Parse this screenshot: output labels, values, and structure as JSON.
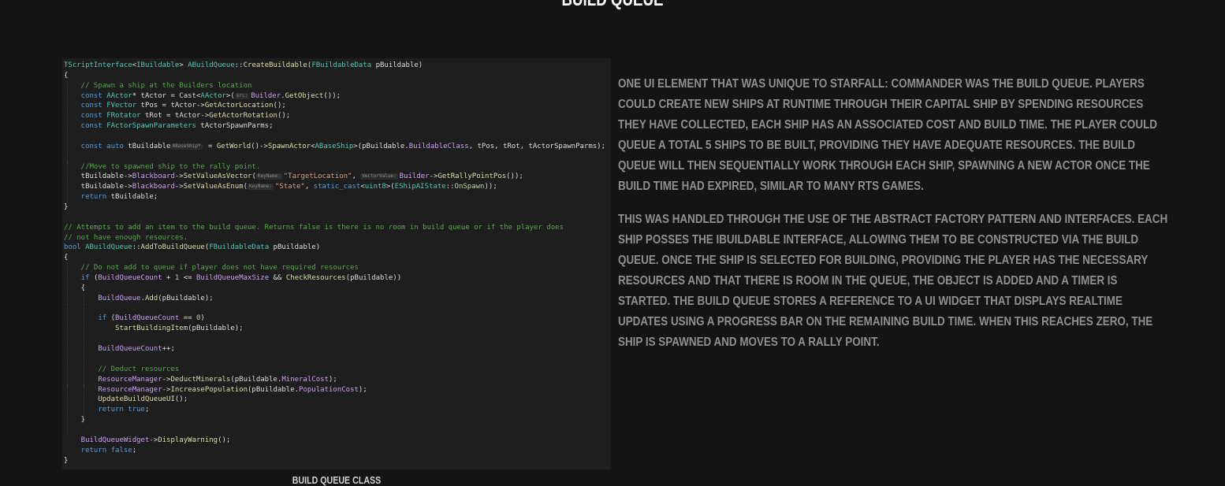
{
  "section": {
    "title": "BUILD QUEUE"
  },
  "code_caption": "BUILD QUEUE CLASS",
  "description": {
    "paragraphs": [
      "ONE UI ELEMENT THAT WAS UNIQUE TO STARFALL: COMMANDER WAS THE BUILD QUEUE. PLAYERS COULD CREATE NEW SHIPS AT RUNTIME THROUGH THEIR CAPITAL SHIP BY SPENDING RESOURCES THEY HAVE COLLECTED, EACH SHIP HAS AN ASSOCIATED COST AND BUILD TIME. THE PLAYER COULD QUEUE A TOTAL 5 SHIPS TO BE BUILT, PROVIDING THEY HAVE ADEQUATE RESOURCES. THE BUILD QUEUE WILL THEN SEQUENTIALLY WORK THROUGH EACH SHIP, SPAWNING A NEW ACTOR ONCE THE BUILD TIME HAD EXPIRED, SIMILAR TO MANY RTS GAMES.",
      "THIS WAS HANDLED THROUGH THE USE OF THE ABSTRACT FACTORY PATTERN AND INTERFACES. EACH SHIP POSSES THE IBUILDABLE INTERFACE, ALLOWING THEM TO BE CONSTRUCTED VIA THE BUILD QUEUE.  ONCE THE SHIP IS SELECTED FOR BUILDING, PROVIDING THE PLAYER HAS THE NECESSARY RESOURCES AND THAT THERE IS ROOM IN THE QUEUE, THE OBJECT IS ADDED AND A TIMER IS STARTED. THE BUILD QUEUE STORES A REFERENCE TO A UI WIDGET THAT DISPLAYS REALTIME UPDATES USING A PROGRESS BAR ON THE REMAINING BUILD TIME. WHEN THIS REACHES ZERO, THE SHIP IS SPAWNED AND MOVES TO A RALLY POINT."
    ]
  },
  "code": {
    "hints": {
      "src": "src:",
      "abaseship": "ABaseShip*",
      "keyname": "KeyName:",
      "vectorvalue": "VectorValue:"
    },
    "lines": [
      {
        "segs": [
          {
            "c": "ty",
            "t": "TScriptInterface"
          },
          {
            "c": "",
            "t": "<"
          },
          {
            "c": "ty",
            "t": "IBuildable"
          },
          {
            "c": "",
            "t": "> "
          },
          {
            "c": "ty",
            "t": "ABuildQueue"
          },
          {
            "c": "",
            "t": "::"
          },
          {
            "c": "fn",
            "t": "CreateBuildable"
          },
          {
            "c": "",
            "t": "("
          },
          {
            "c": "ty",
            "t": "FBuildableData"
          },
          {
            "c": "",
            "t": " pBuildable)"
          }
        ]
      },
      {
        "segs": [
          {
            "c": "",
            "t": "{"
          }
        ]
      },
      {
        "segs": [
          {
            "c": "cm",
            "t": "    // Spawn a ship at the Builders location"
          }
        ]
      },
      {
        "segs": [
          {
            "c": "kw",
            "t": "    const "
          },
          {
            "c": "ty",
            "t": "AActor"
          },
          {
            "c": "",
            "t": "* tActor = Cast<"
          },
          {
            "c": "ty",
            "t": "AActor"
          },
          {
            "c": "",
            "t": ">("
          },
          {
            "c": "hint",
            "t": "src:"
          },
          {
            "c": "mb",
            "t": "Builder"
          },
          {
            "c": "",
            "t": "."
          },
          {
            "c": "fn",
            "t": "GetObject"
          },
          {
            "c": "",
            "t": "());"
          }
        ]
      },
      {
        "segs": [
          {
            "c": "kw",
            "t": "    const "
          },
          {
            "c": "ty",
            "t": "FVector"
          },
          {
            "c": "",
            "t": " tPos = tActor->"
          },
          {
            "c": "fn",
            "t": "GetActorLocation"
          },
          {
            "c": "",
            "t": "();"
          }
        ]
      },
      {
        "segs": [
          {
            "c": "kw",
            "t": "    const "
          },
          {
            "c": "ty",
            "t": "FRotator"
          },
          {
            "c": "",
            "t": " tRot = tActor->"
          },
          {
            "c": "fn",
            "t": "GetActorRotation"
          },
          {
            "c": "",
            "t": "();"
          }
        ]
      },
      {
        "segs": [
          {
            "c": "kw",
            "t": "    const "
          },
          {
            "c": "ty",
            "t": "FActorSpawnParameters"
          },
          {
            "c": "",
            "t": " tActorSpawnParms;"
          }
        ]
      },
      {
        "segs": [
          {
            "c": "",
            "t": " "
          }
        ]
      },
      {
        "segs": [
          {
            "c": "kw",
            "t": "    const auto "
          },
          {
            "c": "",
            "t": "tBuildable"
          },
          {
            "c": "hint",
            "t": "ABaseShip*"
          },
          {
            "c": "",
            "t": " = "
          },
          {
            "c": "fn",
            "t": "GetWorld"
          },
          {
            "c": "",
            "t": "()->"
          },
          {
            "c": "fn",
            "t": "SpawnActor"
          },
          {
            "c": "",
            "t": "<"
          },
          {
            "c": "ty",
            "t": "ABaseShip"
          },
          {
            "c": "",
            "t": ">(pBuildable."
          },
          {
            "c": "mb",
            "t": "BuildableClass"
          },
          {
            "c": "",
            "t": ", tPos, tRot, tActorSpawnParms);"
          }
        ]
      },
      {
        "segs": [
          {
            "c": "",
            "t": " "
          }
        ]
      },
      {
        "segs": [
          {
            "c": "cm",
            "t": "    //Move to spawned ship to the rally point."
          }
        ]
      },
      {
        "segs": [
          {
            "c": "",
            "t": "    tBuildable->"
          },
          {
            "c": "mb",
            "t": "Blackboard"
          },
          {
            "c": "",
            "t": "->"
          },
          {
            "c": "fn",
            "t": "SetValueAsVector"
          },
          {
            "c": "",
            "t": "("
          },
          {
            "c": "hint",
            "t": "KeyName:"
          },
          {
            "c": "st",
            "t": "\"TargetLocation\""
          },
          {
            "c": "",
            "t": ", "
          },
          {
            "c": "hint",
            "t": "VectorValue:"
          },
          {
            "c": "mb",
            "t": "Builder"
          },
          {
            "c": "",
            "t": "->"
          },
          {
            "c": "fn",
            "t": "GetRallyPointPos"
          },
          {
            "c": "",
            "t": "());"
          }
        ]
      },
      {
        "segs": [
          {
            "c": "",
            "t": "    tBuildable->"
          },
          {
            "c": "mb",
            "t": "Blackboard"
          },
          {
            "c": "",
            "t": "->"
          },
          {
            "c": "fn",
            "t": "SetValueAsEnum"
          },
          {
            "c": "",
            "t": "("
          },
          {
            "c": "hint",
            "t": "KeyName:"
          },
          {
            "c": "st",
            "t": "\"State\""
          },
          {
            "c": "",
            "t": ", "
          },
          {
            "c": "kw",
            "t": "static_cast"
          },
          {
            "c": "",
            "t": "<"
          },
          {
            "c": "ty",
            "t": "uint8"
          },
          {
            "c": "",
            "t": ">("
          },
          {
            "c": "ty",
            "t": "EShipAIState"
          },
          {
            "c": "",
            "t": "::"
          },
          {
            "c": "en",
            "t": "OnSpawn"
          },
          {
            "c": "",
            "t": "));"
          }
        ]
      },
      {
        "segs": [
          {
            "c": "kw",
            "t": "    return "
          },
          {
            "c": "",
            "t": "tBuildable;"
          }
        ]
      },
      {
        "segs": [
          {
            "c": "",
            "t": "}"
          }
        ]
      },
      {
        "segs": [
          {
            "c": "",
            "t": " "
          }
        ]
      },
      {
        "segs": [
          {
            "c": "cm",
            "t": "// Attempts to add an item to the build queue. Returns false is there is no room in build queue or if the player does"
          }
        ]
      },
      {
        "segs": [
          {
            "c": "cm",
            "t": "// not have enough resources."
          }
        ]
      },
      {
        "segs": [
          {
            "c": "kw",
            "t": "bool "
          },
          {
            "c": "ty",
            "t": "ABuildQueue"
          },
          {
            "c": "",
            "t": "::"
          },
          {
            "c": "fn",
            "t": "AddToBuildQueue"
          },
          {
            "c": "",
            "t": "("
          },
          {
            "c": "ty",
            "t": "FBuildableData"
          },
          {
            "c": "",
            "t": " pBuildable)"
          }
        ]
      },
      {
        "segs": [
          {
            "c": "",
            "t": "{"
          }
        ]
      },
      {
        "segs": [
          {
            "c": "cm",
            "t": "    // Do not add to queue if player does not have required resources"
          }
        ]
      },
      {
        "segs": [
          {
            "c": "kw",
            "t": "    if "
          },
          {
            "c": "",
            "t": "("
          },
          {
            "c": "mb",
            "t": "BuildQueueCount"
          },
          {
            "c": "",
            "t": " + "
          },
          {
            "c": "nm",
            "t": "1"
          },
          {
            "c": "",
            "t": " <= "
          },
          {
            "c": "mb",
            "t": "BuildQueueMaxSize"
          },
          {
            "c": "",
            "t": " && "
          },
          {
            "c": "fn",
            "t": "CheckResources"
          },
          {
            "c": "",
            "t": "(pBuildable))"
          }
        ]
      },
      {
        "segs": [
          {
            "c": "",
            "t": "    {"
          }
        ]
      },
      {
        "segs": [
          {
            "c": "mb",
            "t": "        BuildQueue"
          },
          {
            "c": "",
            "t": "."
          },
          {
            "c": "fn",
            "t": "Add"
          },
          {
            "c": "",
            "t": "(pBuildable);"
          }
        ]
      },
      {
        "segs": [
          {
            "c": "",
            "t": " "
          }
        ]
      },
      {
        "segs": [
          {
            "c": "kw",
            "t": "        if "
          },
          {
            "c": "",
            "t": "("
          },
          {
            "c": "mb",
            "t": "BuildQueueCount"
          },
          {
            "c": "",
            "t": " == "
          },
          {
            "c": "nm",
            "t": "0"
          },
          {
            "c": "",
            "t": ")"
          }
        ]
      },
      {
        "segs": [
          {
            "c": "fn",
            "t": "            StartBuildingItem"
          },
          {
            "c": "",
            "t": "(pBuildable);"
          }
        ]
      },
      {
        "segs": [
          {
            "c": "",
            "t": " "
          }
        ]
      },
      {
        "segs": [
          {
            "c": "mb",
            "t": "        BuildQueueCount"
          },
          {
            "c": "",
            "t": "++;"
          }
        ]
      },
      {
        "segs": [
          {
            "c": "",
            "t": " "
          }
        ]
      },
      {
        "segs": [
          {
            "c": "cm",
            "t": "        // Deduct resources"
          }
        ]
      },
      {
        "segs": [
          {
            "c": "mb",
            "t": "        ResourceManager"
          },
          {
            "c": "",
            "t": "->"
          },
          {
            "c": "fn",
            "t": "DeductMinerals"
          },
          {
            "c": "",
            "t": "(pBuildable."
          },
          {
            "c": "mb",
            "t": "MineralCost"
          },
          {
            "c": "",
            "t": ");"
          }
        ]
      },
      {
        "segs": [
          {
            "c": "mb",
            "t": "        ResourceManager"
          },
          {
            "c": "",
            "t": "->"
          },
          {
            "c": "fn",
            "t": "IncreasePopulation"
          },
          {
            "c": "",
            "t": "(pBuildable."
          },
          {
            "c": "mb",
            "t": "PopulationCost"
          },
          {
            "c": "",
            "t": ");"
          }
        ]
      },
      {
        "segs": [
          {
            "c": "fn",
            "t": "        UpdateBuildQueueUI"
          },
          {
            "c": "",
            "t": "();"
          }
        ]
      },
      {
        "segs": [
          {
            "c": "kw",
            "t": "        return true"
          },
          {
            "c": "",
            "t": ";"
          }
        ]
      },
      {
        "segs": [
          {
            "c": "",
            "t": "    }"
          }
        ]
      },
      {
        "segs": [
          {
            "c": "",
            "t": " "
          }
        ]
      },
      {
        "segs": [
          {
            "c": "mb",
            "t": "    BuildQueueWidget"
          },
          {
            "c": "",
            "t": "->"
          },
          {
            "c": "fn",
            "t": "DisplayWarning"
          },
          {
            "c": "",
            "t": "();"
          }
        ]
      },
      {
        "segs": [
          {
            "c": "kw",
            "t": "    return false"
          },
          {
            "c": "",
            "t": ";"
          }
        ]
      },
      {
        "segs": [
          {
            "c": "",
            "t": "}"
          }
        ]
      }
    ]
  },
  "colors": {
    "background": "#141414",
    "code_background": "#1e1e1e",
    "body_text": "#8f8f8f",
    "heading_text": "#ffffff"
  }
}
